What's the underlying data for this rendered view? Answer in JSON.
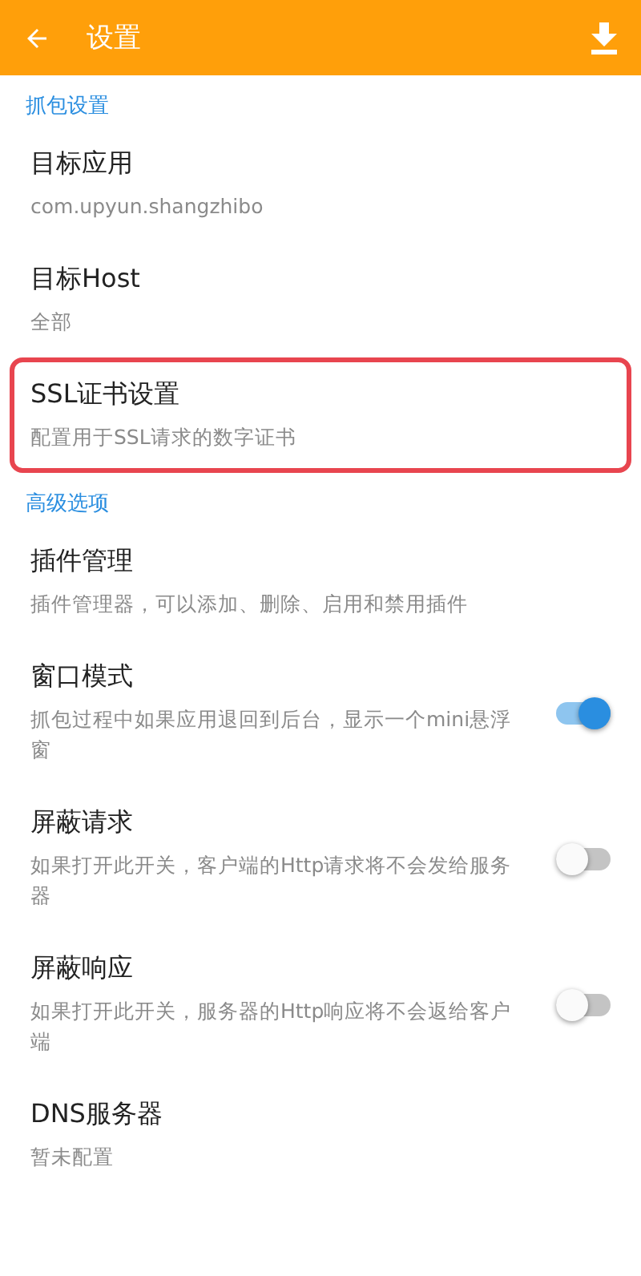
{
  "app_bar": {
    "title": "设置"
  },
  "sections": [
    {
      "header": "抓包设置",
      "items": [
        {
          "kind": "plain",
          "title": "目标应用",
          "summary": "com.upyun.shangzhibo",
          "highlighted": false
        },
        {
          "kind": "plain",
          "title": "目标Host",
          "summary": "全部",
          "highlighted": false
        },
        {
          "kind": "plain",
          "title": "SSL证书设置",
          "summary": "配置用于SSL请求的数字证书",
          "highlighted": true
        }
      ]
    },
    {
      "header": "高级选项",
      "items": [
        {
          "kind": "plain",
          "title": "插件管理",
          "summary": "插件管理器，可以添加、删除、启用和禁用插件",
          "highlighted": false
        },
        {
          "kind": "switch",
          "title": "窗口模式",
          "summary": "抓包过程中如果应用退回到后台，显示一个mini悬浮窗",
          "on": true,
          "highlighted": false
        },
        {
          "kind": "switch",
          "title": "屏蔽请求",
          "summary": "如果打开此开关，客户端的Http请求将不会发给服务器",
          "on": false,
          "highlighted": false
        },
        {
          "kind": "switch",
          "title": "屏蔽响应",
          "summary": "如果打开此开关，服务器的Http响应将不会返给客户端",
          "on": false,
          "highlighted": false
        },
        {
          "kind": "plain",
          "title": "DNS服务器",
          "summary": "暂未配置",
          "highlighted": false
        }
      ]
    }
  ]
}
